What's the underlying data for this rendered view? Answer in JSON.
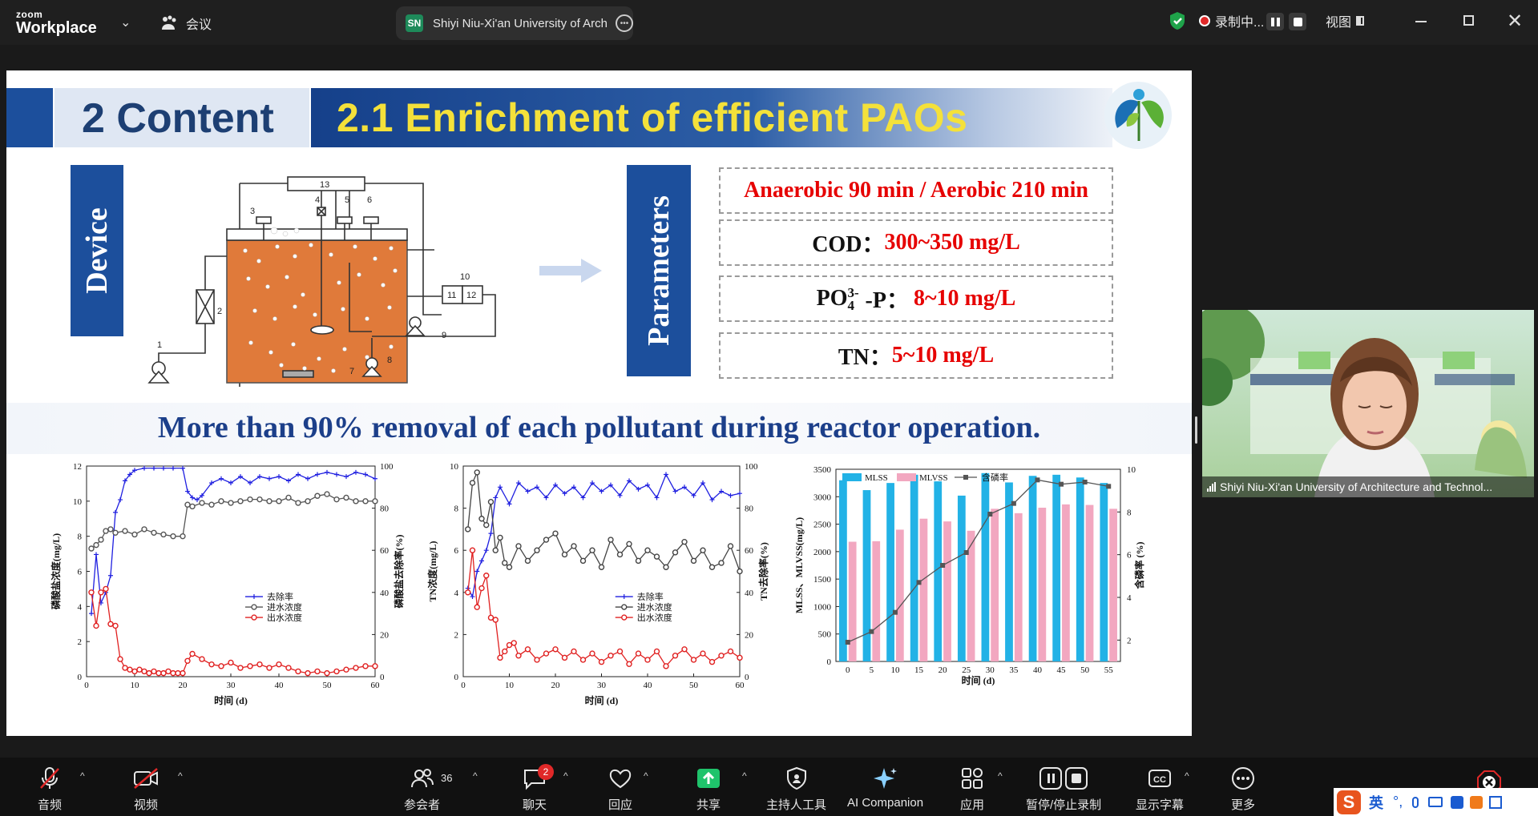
{
  "app": {
    "logo_small": "zoom",
    "logo_big": "Workplace",
    "meeting_label": "会议"
  },
  "title_pill": {
    "initials": "SN",
    "name": "Shiyi Niu-Xi'an University of Arch"
  },
  "topbar_right": {
    "recording": "录制中...",
    "view": "视图"
  },
  "colors": {
    "slide_blue": "#1c4f9c",
    "title_yellow": "#f4e13a",
    "param_red": "#e60000",
    "band_text": "#1c3f8a",
    "toolbar_bg": "#111111"
  },
  "slide": {
    "section_title": "2 Content",
    "subtitle": "2.1 Enrichment of efficient PAOs",
    "device_label": "Device",
    "parameters_label": "Parameters",
    "params": {
      "p1": "Anaerobic 90 min / Aerobic 210 min",
      "cod_label": "COD：",
      "cod_value": "300~350 mg/L",
      "po4_label_a": "PO",
      "po4_sub": "4",
      "po4_sup": "3-",
      "po4_label_b": "-P：",
      "po4_value": "8~10 mg/L",
      "tn_label": "TN：",
      "tn_value": "5~10 mg/L"
    },
    "headline": "More than 90% removal of each pollutant during reactor operation.",
    "diagram_numbers": [
      "1",
      "2",
      "3",
      "4",
      "5",
      "6",
      "7",
      "8",
      "9",
      "10",
      "11",
      "12",
      "13"
    ]
  },
  "chart_data": [
    {
      "type": "line",
      "ylabel": "磷酸盐浓度(mg/L)",
      "y2label": "磷酸盐去除率(%)",
      "xlabel": "时间 (d)",
      "xlim": [
        0,
        60
      ],
      "ylim": [
        0,
        12
      ],
      "y2lim": [
        0,
        100
      ],
      "xticks": [
        "0",
        "10",
        "20",
        "30",
        "40",
        "50",
        "60"
      ],
      "yticks": [
        "0",
        "2",
        "4",
        "6",
        "8",
        "10",
        "12"
      ],
      "y2ticks": [
        "0",
        "20",
        "40",
        "60",
        "80",
        "100"
      ],
      "legend": [
        "去除率",
        "进水浓度",
        "出水浓度"
      ],
      "series": [
        {
          "name": "去除率",
          "color": "#1f1fe0",
          "axis": "right",
          "x": [
            1,
            2,
            3,
            4,
            5,
            6,
            7,
            8,
            9,
            10,
            12,
            14,
            16,
            18,
            20,
            21,
            22,
            23,
            24,
            26,
            28,
            30,
            32,
            34,
            36,
            38,
            40,
            42,
            44,
            46,
            48,
            50,
            52,
            54,
            56,
            58,
            60
          ],
          "values": [
            30,
            58,
            35,
            40,
            48,
            78,
            84,
            93,
            96,
            98,
            99,
            99,
            99,
            99,
            99,
            88,
            85,
            84,
            86,
            92,
            94,
            92,
            95,
            92,
            95,
            94,
            95,
            93,
            96,
            94,
            96,
            97,
            96,
            95,
            97,
            96,
            94
          ]
        },
        {
          "name": "进水浓度",
          "color": "#555555",
          "axis": "left",
          "x": [
            1,
            2,
            3,
            4,
            5,
            6,
            8,
            10,
            12,
            14,
            16,
            18,
            20,
            21,
            22,
            24,
            26,
            28,
            30,
            32,
            34,
            36,
            38,
            40,
            42,
            44,
            46,
            48,
            50,
            52,
            54,
            56,
            58,
            60
          ],
          "values": [
            7.3,
            7.5,
            7.8,
            8.3,
            8.4,
            8.2,
            8.3,
            8.1,
            8.4,
            8.2,
            8.1,
            8.0,
            8.0,
            9.8,
            9.7,
            9.9,
            9.8,
            10.0,
            9.9,
            10.0,
            10.1,
            10.1,
            10.0,
            10.0,
            10.2,
            9.9,
            10.0,
            10.3,
            10.4,
            10.1,
            10.2,
            10.0,
            10.0,
            10.0
          ]
        },
        {
          "name": "出水浓度",
          "color": "#e02020",
          "axis": "left",
          "x": [
            1,
            2,
            3,
            4,
            5,
            6,
            7,
            8,
            9,
            10,
            11,
            12,
            13,
            14,
            15,
            16,
            17,
            18,
            19,
            20,
            21,
            22,
            24,
            26,
            28,
            30,
            32,
            34,
            36,
            38,
            40,
            42,
            44,
            46,
            48,
            50,
            52,
            54,
            56,
            58,
            60
          ],
          "values": [
            4.8,
            2.9,
            4.8,
            5.0,
            3.0,
            2.9,
            1.0,
            0.5,
            0.4,
            0.3,
            0.4,
            0.3,
            0.2,
            0.3,
            0.2,
            0.2,
            0.3,
            0.2,
            0.2,
            0.2,
            0.9,
            1.3,
            1.0,
            0.7,
            0.6,
            0.8,
            0.5,
            0.6,
            0.7,
            0.5,
            0.7,
            0.5,
            0.3,
            0.2,
            0.3,
            0.2,
            0.3,
            0.4,
            0.5,
            0.6,
            0.6
          ]
        }
      ]
    },
    {
      "type": "line",
      "ylabel": "TN浓度(mg/L)",
      "y2label": "TN去除率(%)",
      "xlabel": "时间 (d)",
      "xlim": [
        0,
        60
      ],
      "ylim": [
        0,
        10
      ],
      "y2lim": [
        0,
        100
      ],
      "xticks": [
        "0",
        "10",
        "20",
        "30",
        "40",
        "50",
        "60"
      ],
      "yticks": [
        "0",
        "2",
        "4",
        "6",
        "8",
        "10"
      ],
      "y2ticks": [
        "0",
        "20",
        "40",
        "60",
        "80",
        "100"
      ],
      "legend": [
        "去除率",
        "进水浓度",
        "出水浓度"
      ],
      "series": [
        {
          "name": "去除率",
          "color": "#1f1fe0",
          "axis": "right",
          "x": [
            1,
            2,
            3,
            4,
            5,
            6,
            7,
            8,
            10,
            12,
            14,
            16,
            18,
            20,
            22,
            24,
            26,
            28,
            30,
            32,
            34,
            36,
            38,
            40,
            42,
            44,
            46,
            48,
            50,
            52,
            54,
            56,
            58,
            60
          ],
          "values": [
            42,
            38,
            50,
            55,
            60,
            68,
            85,
            90,
            82,
            92,
            88,
            90,
            85,
            91,
            87,
            90,
            85,
            92,
            88,
            91,
            86,
            93,
            89,
            91,
            85,
            96,
            88,
            90,
            86,
            92,
            84,
            88,
            86,
            87
          ]
        },
        {
          "name": "进水浓度",
          "color": "#444444",
          "axis": "left",
          "x": [
            1,
            2,
            3,
            4,
            5,
            6,
            7,
            8,
            9,
            10,
            12,
            14,
            16,
            18,
            20,
            22,
            24,
            26,
            28,
            30,
            32,
            34,
            36,
            38,
            40,
            42,
            44,
            46,
            48,
            50,
            52,
            54,
            56,
            58,
            60
          ],
          "values": [
            7.0,
            9.2,
            9.7,
            7.5,
            7.2,
            8.3,
            6.0,
            6.6,
            5.4,
            5.2,
            6.2,
            5.5,
            6.0,
            6.5,
            6.8,
            5.8,
            6.2,
            5.5,
            6.0,
            5.2,
            6.5,
            5.8,
            6.3,
            5.5,
            6.0,
            5.7,
            5.2,
            5.9,
            6.4,
            5.5,
            6.0,
            5.2,
            5.4,
            6.2,
            5.0
          ]
        },
        {
          "name": "出水浓度",
          "color": "#e02020",
          "axis": "left",
          "x": [
            1,
            2,
            3,
            4,
            5,
            6,
            7,
            8,
            9,
            10,
            11,
            12,
            14,
            16,
            18,
            20,
            22,
            24,
            26,
            28,
            30,
            32,
            34,
            36,
            38,
            40,
            42,
            44,
            46,
            48,
            50,
            52,
            54,
            56,
            58,
            60
          ],
          "values": [
            4.0,
            6.0,
            3.3,
            4.2,
            4.8,
            2.8,
            2.7,
            0.9,
            1.2,
            1.5,
            1.6,
            1.0,
            1.3,
            0.8,
            1.1,
            1.3,
            0.9,
            1.2,
            0.8,
            1.1,
            0.7,
            1.0,
            1.2,
            0.6,
            1.1,
            0.8,
            1.2,
            0.5,
            1.0,
            1.3,
            0.8,
            1.1,
            0.7,
            1.0,
            1.2,
            0.9
          ]
        }
      ]
    },
    {
      "type": "bar",
      "ylabel": "MLSS、MLVSS(mg/L)",
      "y2label": "含磷率 (%)",
      "xlabel": "时间 (d)",
      "ylim": [
        0,
        3500
      ],
      "y2lim": [
        1,
        10
      ],
      "categories": [
        "0",
        "5",
        "10",
        "15",
        "20",
        "25",
        "30",
        "35",
        "40",
        "45",
        "50",
        "55"
      ],
      "yticks": [
        "0",
        "500",
        "1000",
        "1500",
        "2000",
        "2500",
        "3000",
        "3500"
      ],
      "y2ticks": [
        "2",
        "4",
        "6",
        "8",
        "10"
      ],
      "legend": [
        "MLSS",
        "MLVSS",
        "含磷率"
      ],
      "series": [
        {
          "name": "MLSS",
          "color": "#22b2e6",
          "axis": "left",
          "values": [
            3300,
            3120,
            3250,
            3400,
            3280,
            3020,
            3430,
            3260,
            3380,
            3400,
            3350,
            3250
          ]
        },
        {
          "name": "MLVSS",
          "color": "#f2a7c0",
          "axis": "left",
          "values": [
            2180,
            2190,
            2400,
            2600,
            2550,
            2380,
            2780,
            2700,
            2800,
            2860,
            2850,
            2780
          ]
        },
        {
          "name": "含磷率",
          "color": "#555555",
          "axis": "right",
          "type": "line",
          "values": [
            1.9,
            2.4,
            3.3,
            4.7,
            5.5,
            6.1,
            7.9,
            8.4,
            9.5,
            9.3,
            9.4,
            9.2
          ]
        }
      ]
    }
  ],
  "video": {
    "name": "Shiyi Niu-Xi'an University of Architecture and Technol..."
  },
  "toolbar": {
    "audio": "音频",
    "video": "视频",
    "participants": "参会者",
    "participants_count": "36",
    "chat": "聊天",
    "chat_badge": "2",
    "react": "回应",
    "share": "共享",
    "host_tools": "主持人工具",
    "ai": "AI Companion",
    "apps": "应用",
    "record": "暂停/停止录制",
    "captions": "显示字幕",
    "more": "更多"
  },
  "ime": {
    "lang": "英"
  }
}
